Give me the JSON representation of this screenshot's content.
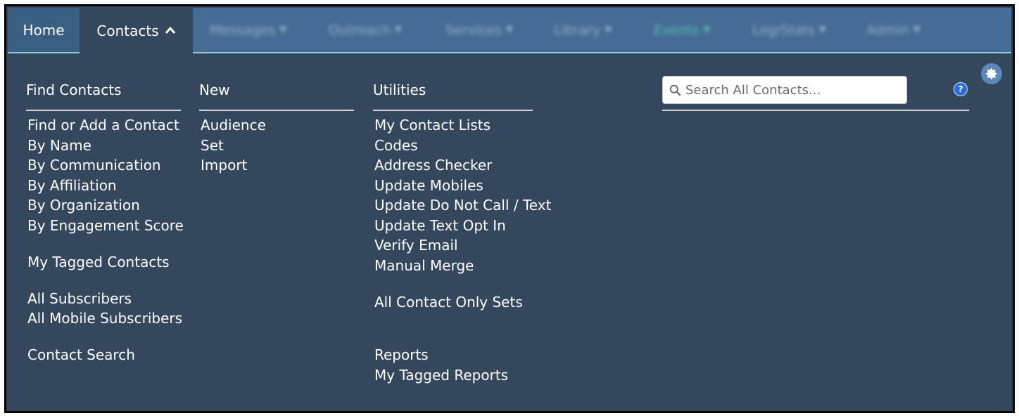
{
  "nav": {
    "home": "Home",
    "contacts": "Contacts",
    "blurred_tabs": [
      "Messages",
      "Outreach",
      "Services",
      "Library",
      "Events",
      "Log/Stats",
      "Admin"
    ]
  },
  "columns": {
    "find": {
      "heading": "Find Contacts",
      "links": [
        "Find or Add a Contact",
        "By Name",
        "By Communication",
        "By Affiliation",
        "By Organization",
        "By Engagement Score",
        "My Tagged Contacts",
        "All Subscribers",
        "All Mobile Subscribers",
        "Contact Search"
      ]
    },
    "new": {
      "heading": "New",
      "links": [
        "Audience",
        "Set",
        "Import"
      ]
    },
    "utilities": {
      "heading": "Utilities",
      "links": [
        "My Contact Lists",
        "Codes",
        "Address Checker",
        "Update Mobiles",
        "Update Do Not Call / Text",
        "Update Text Opt In",
        "Verify Email",
        "Manual Merge",
        "All Contact Only Sets",
        "Reports",
        "My Tagged Reports"
      ]
    }
  },
  "search": {
    "placeholder": "Search All Contacts..."
  },
  "help_label": "?",
  "colors": {
    "panel_bg": "#34475d",
    "nav_bg": "#466c95",
    "accent_line": "#8fd0d6"
  },
  "icons": {
    "search": "search-icon",
    "settings": "gear-icon",
    "help": "help-icon",
    "caret": "chevron-up-icon"
  }
}
